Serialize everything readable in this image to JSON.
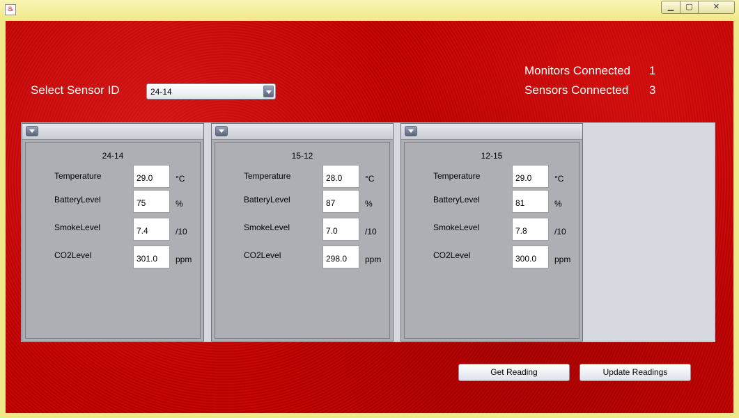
{
  "window": {
    "icon": "java-cup-icon",
    "controls": {
      "minimize": "▁",
      "maximize": "▢",
      "close": "✕"
    }
  },
  "header": {
    "select_label": "Select Sensor ID",
    "selected_sensor": "24-14",
    "monitors_label": "Monitors Connected",
    "monitors_count": "1",
    "sensors_label": "Sensors Connected",
    "sensors_count": "3"
  },
  "labels": {
    "temperature": "Temperature",
    "battery": "BatteryLevel",
    "smoke": "SmokeLevel",
    "co2": "CO2Level"
  },
  "units": {
    "temperature": "°C",
    "battery": "%",
    "smoke": "/10",
    "co2": "ppm"
  },
  "sensors": [
    {
      "id": "24-14",
      "temperature": "29.0",
      "battery": "75",
      "smoke": "7.4",
      "co2": "301.0"
    },
    {
      "id": "15-12",
      "temperature": "28.0",
      "battery": "87",
      "smoke": "7.0",
      "co2": "298.0"
    },
    {
      "id": "12-15",
      "temperature": "29.0",
      "battery": "81",
      "smoke": "7.8",
      "co2": "300.0"
    }
  ],
  "buttons": {
    "get_reading": "Get Reading",
    "update_readings": "Update Readings"
  },
  "colors": {
    "background": "#c00000",
    "window_frame": "#efe889",
    "panel": "#aeb0b5"
  }
}
